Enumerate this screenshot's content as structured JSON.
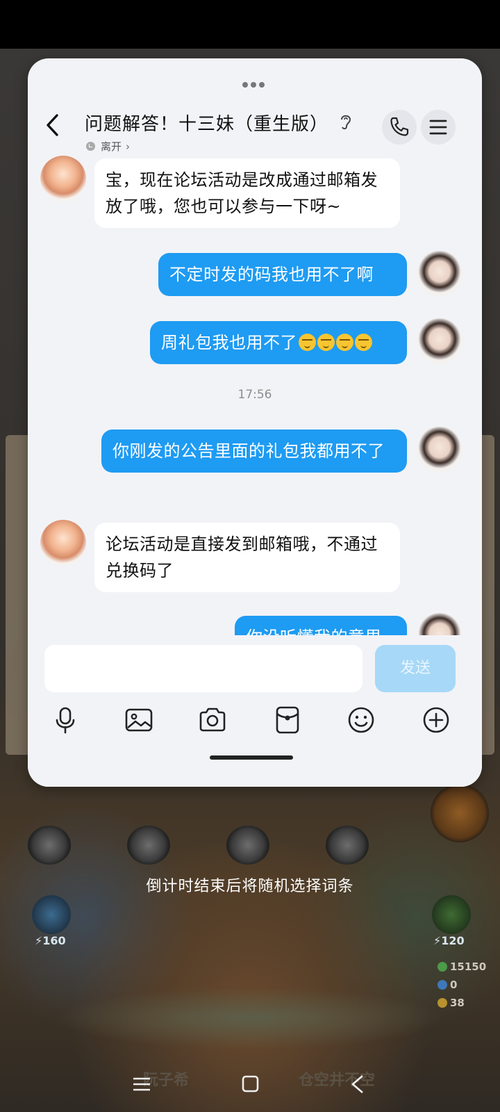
{
  "game": {
    "countdown_text": "倒计时结束后将随机选择词条",
    "energy_left": "160",
    "energy_right": "120",
    "stats": [
      "15150",
      "0",
      "38"
    ],
    "bottom_left_label": "阮子希",
    "bottom_right_label": "仓空井不空"
  },
  "chat": {
    "title": "问题解答！十三妹（重生版）",
    "presence": "离开",
    "messages": [
      {
        "sender": "cs",
        "text": "宝，现在论坛活动是改成通过邮箱发放了哦，您也可以参与一下呀~"
      },
      {
        "sender": "me",
        "text": "不定时发的码我也用不了啊"
      },
      {
        "sender": "me",
        "text": "周礼包我也用不了",
        "emoji_count": 4
      },
      {
        "timestamp": "17:56"
      },
      {
        "sender": "me",
        "text": "你刚发的公告里面的礼包我都用不了"
      },
      {
        "sender": "cs",
        "text": "论坛活动是直接发到邮箱哦，不通过兑换码了"
      },
      {
        "sender": "me",
        "text": "你没听懂我的意思"
      }
    ],
    "input": {
      "value": "",
      "placeholder": ""
    },
    "send_label": "发送",
    "toolbar_icons": [
      "microphone-icon",
      "image-icon",
      "camera-icon",
      "red-packet-icon",
      "emoji-icon",
      "plus-icon"
    ]
  },
  "colors": {
    "outgoing_bubble": "#1e9bf2",
    "incoming_bubble": "#ffffff",
    "send_button": "#a7d8f7"
  }
}
